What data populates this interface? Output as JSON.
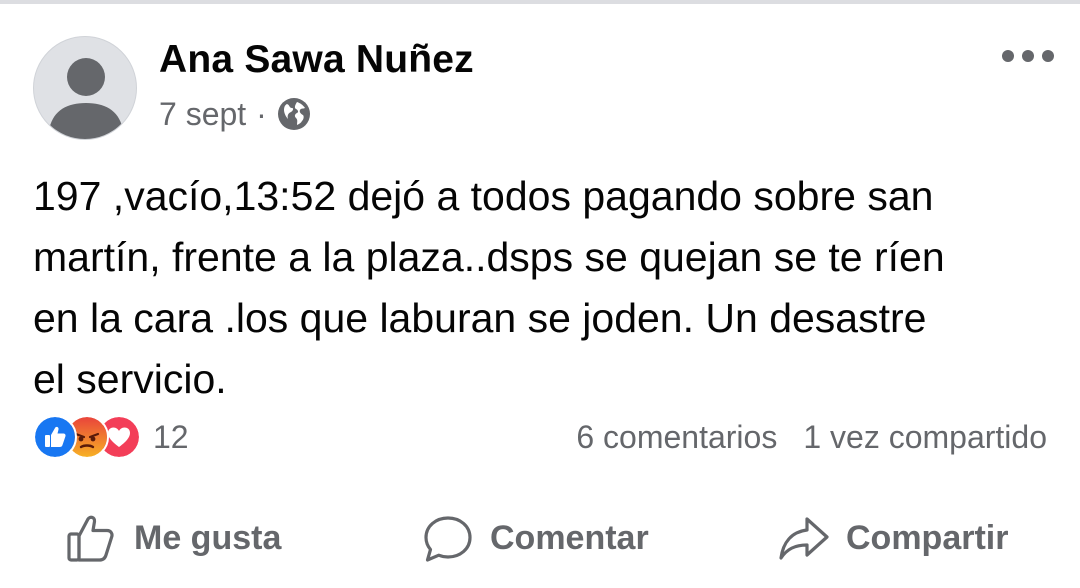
{
  "post": {
    "author": "Ana Sawa Nuñez",
    "date": "7 sept",
    "separator": "·",
    "privacy_icon": "globe-icon",
    "more_icon": "more-options-icon",
    "text_lines": [
      "197 ,vacío,13:52 dejó a todos pagando sobre san",
      "martín, frente a la plaza..dsps se quejan se te ríen",
      "en la cara .los que laburan se joden. Un desastre",
      "el servicio."
    ]
  },
  "reactions": {
    "icons": [
      "like-reaction-icon",
      "angry-reaction-icon",
      "love-reaction-icon"
    ],
    "count": "12",
    "colors": {
      "like": "#1877f2",
      "angry": "#f0734a",
      "love": "#f33e58"
    }
  },
  "stats": {
    "comments": "6 comentarios",
    "shares": "1 vez compartido"
  },
  "actions": {
    "like": "Me gusta",
    "comment": "Comentar",
    "share": "Compartir"
  },
  "colors": {
    "text_primary": "#050505",
    "text_secondary": "#65676b",
    "avatar_bg": "#dfe1e5",
    "avatar_fg": "#8a8d91"
  }
}
